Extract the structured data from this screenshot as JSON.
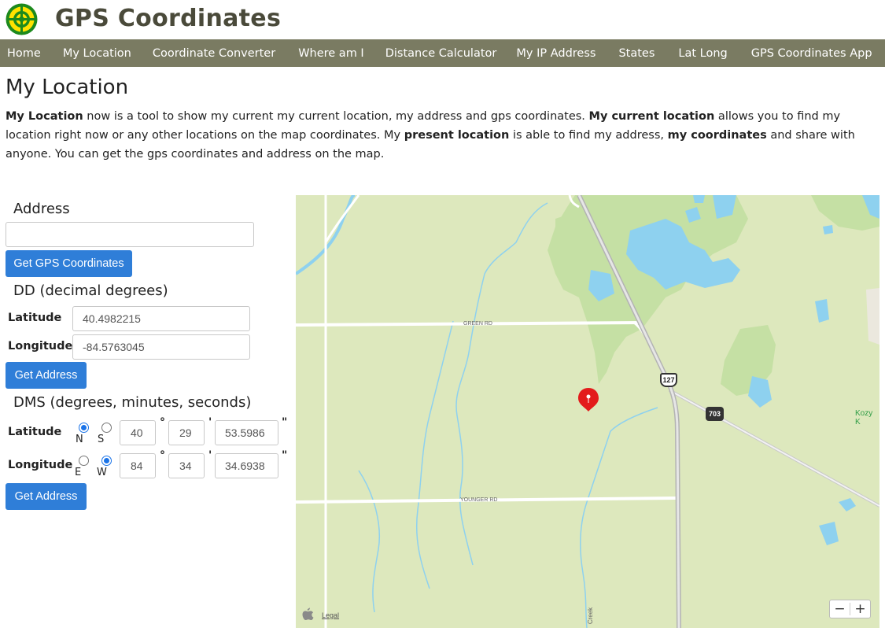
{
  "site": {
    "title": "GPS Coordinates"
  },
  "nav": [
    "Home",
    "My Location",
    "Coordinate Converter",
    "Where am I",
    "Distance Calculator",
    "My IP Address",
    "States",
    "Lat Long",
    "GPS Coordinates App"
  ],
  "page": {
    "title": "My Location",
    "intro": {
      "s1_bold": "My Location",
      "s1": " now is a tool to show my current my current location, my address and gps coordinates. ",
      "s2_bold": "My current location",
      "s2": " allows you to find my location right now or any other locations on the map coordinates. My ",
      "s3_bold": "present location",
      "s3": " is able to find my address, ",
      "s4_bold": "my coordinates",
      "s4": " and share with anyone. You can get the gps coordinates and address on the map."
    }
  },
  "form": {
    "address_label": "Address",
    "address_value": "",
    "get_gps_button": "Get GPS Coordinates",
    "dd_label": "DD (decimal degrees)",
    "latitude_label": "Latitude",
    "longitude_label": "Longitude",
    "dd_latitude": "40.4982215",
    "dd_longitude": "-84.5763045",
    "get_address_button": "Get Address",
    "dms_label": "DMS (degrees, minutes, seconds)",
    "dms_lat": {
      "hemi_a": "N",
      "hemi_b": "S",
      "selected": "N",
      "deg": "40",
      "min": "29",
      "sec": "53.5986"
    },
    "dms_lon": {
      "hemi_a": "E",
      "hemi_b": "W",
      "selected": "W",
      "deg": "84",
      "min": "34",
      "sec": "34.6938"
    },
    "degree_symbol": "°",
    "minute_symbol": "'",
    "second_symbol": "\""
  },
  "map": {
    "roads": {
      "green": "GREEN RD",
      "younger": "YOUNGER RD"
    },
    "route_127": "127",
    "route_703": "703",
    "place": "Kozy K",
    "creek": "Creek",
    "legal": "Legal",
    "zoom_out": "−",
    "zoom_in": "+",
    "colors": {
      "land": "#dde8bd",
      "forest": "#c5e0a4",
      "water": "#8ed1ef",
      "pin": "#e31b1b",
      "nav": "#7a7b62",
      "button": "#2f7ed8"
    }
  }
}
